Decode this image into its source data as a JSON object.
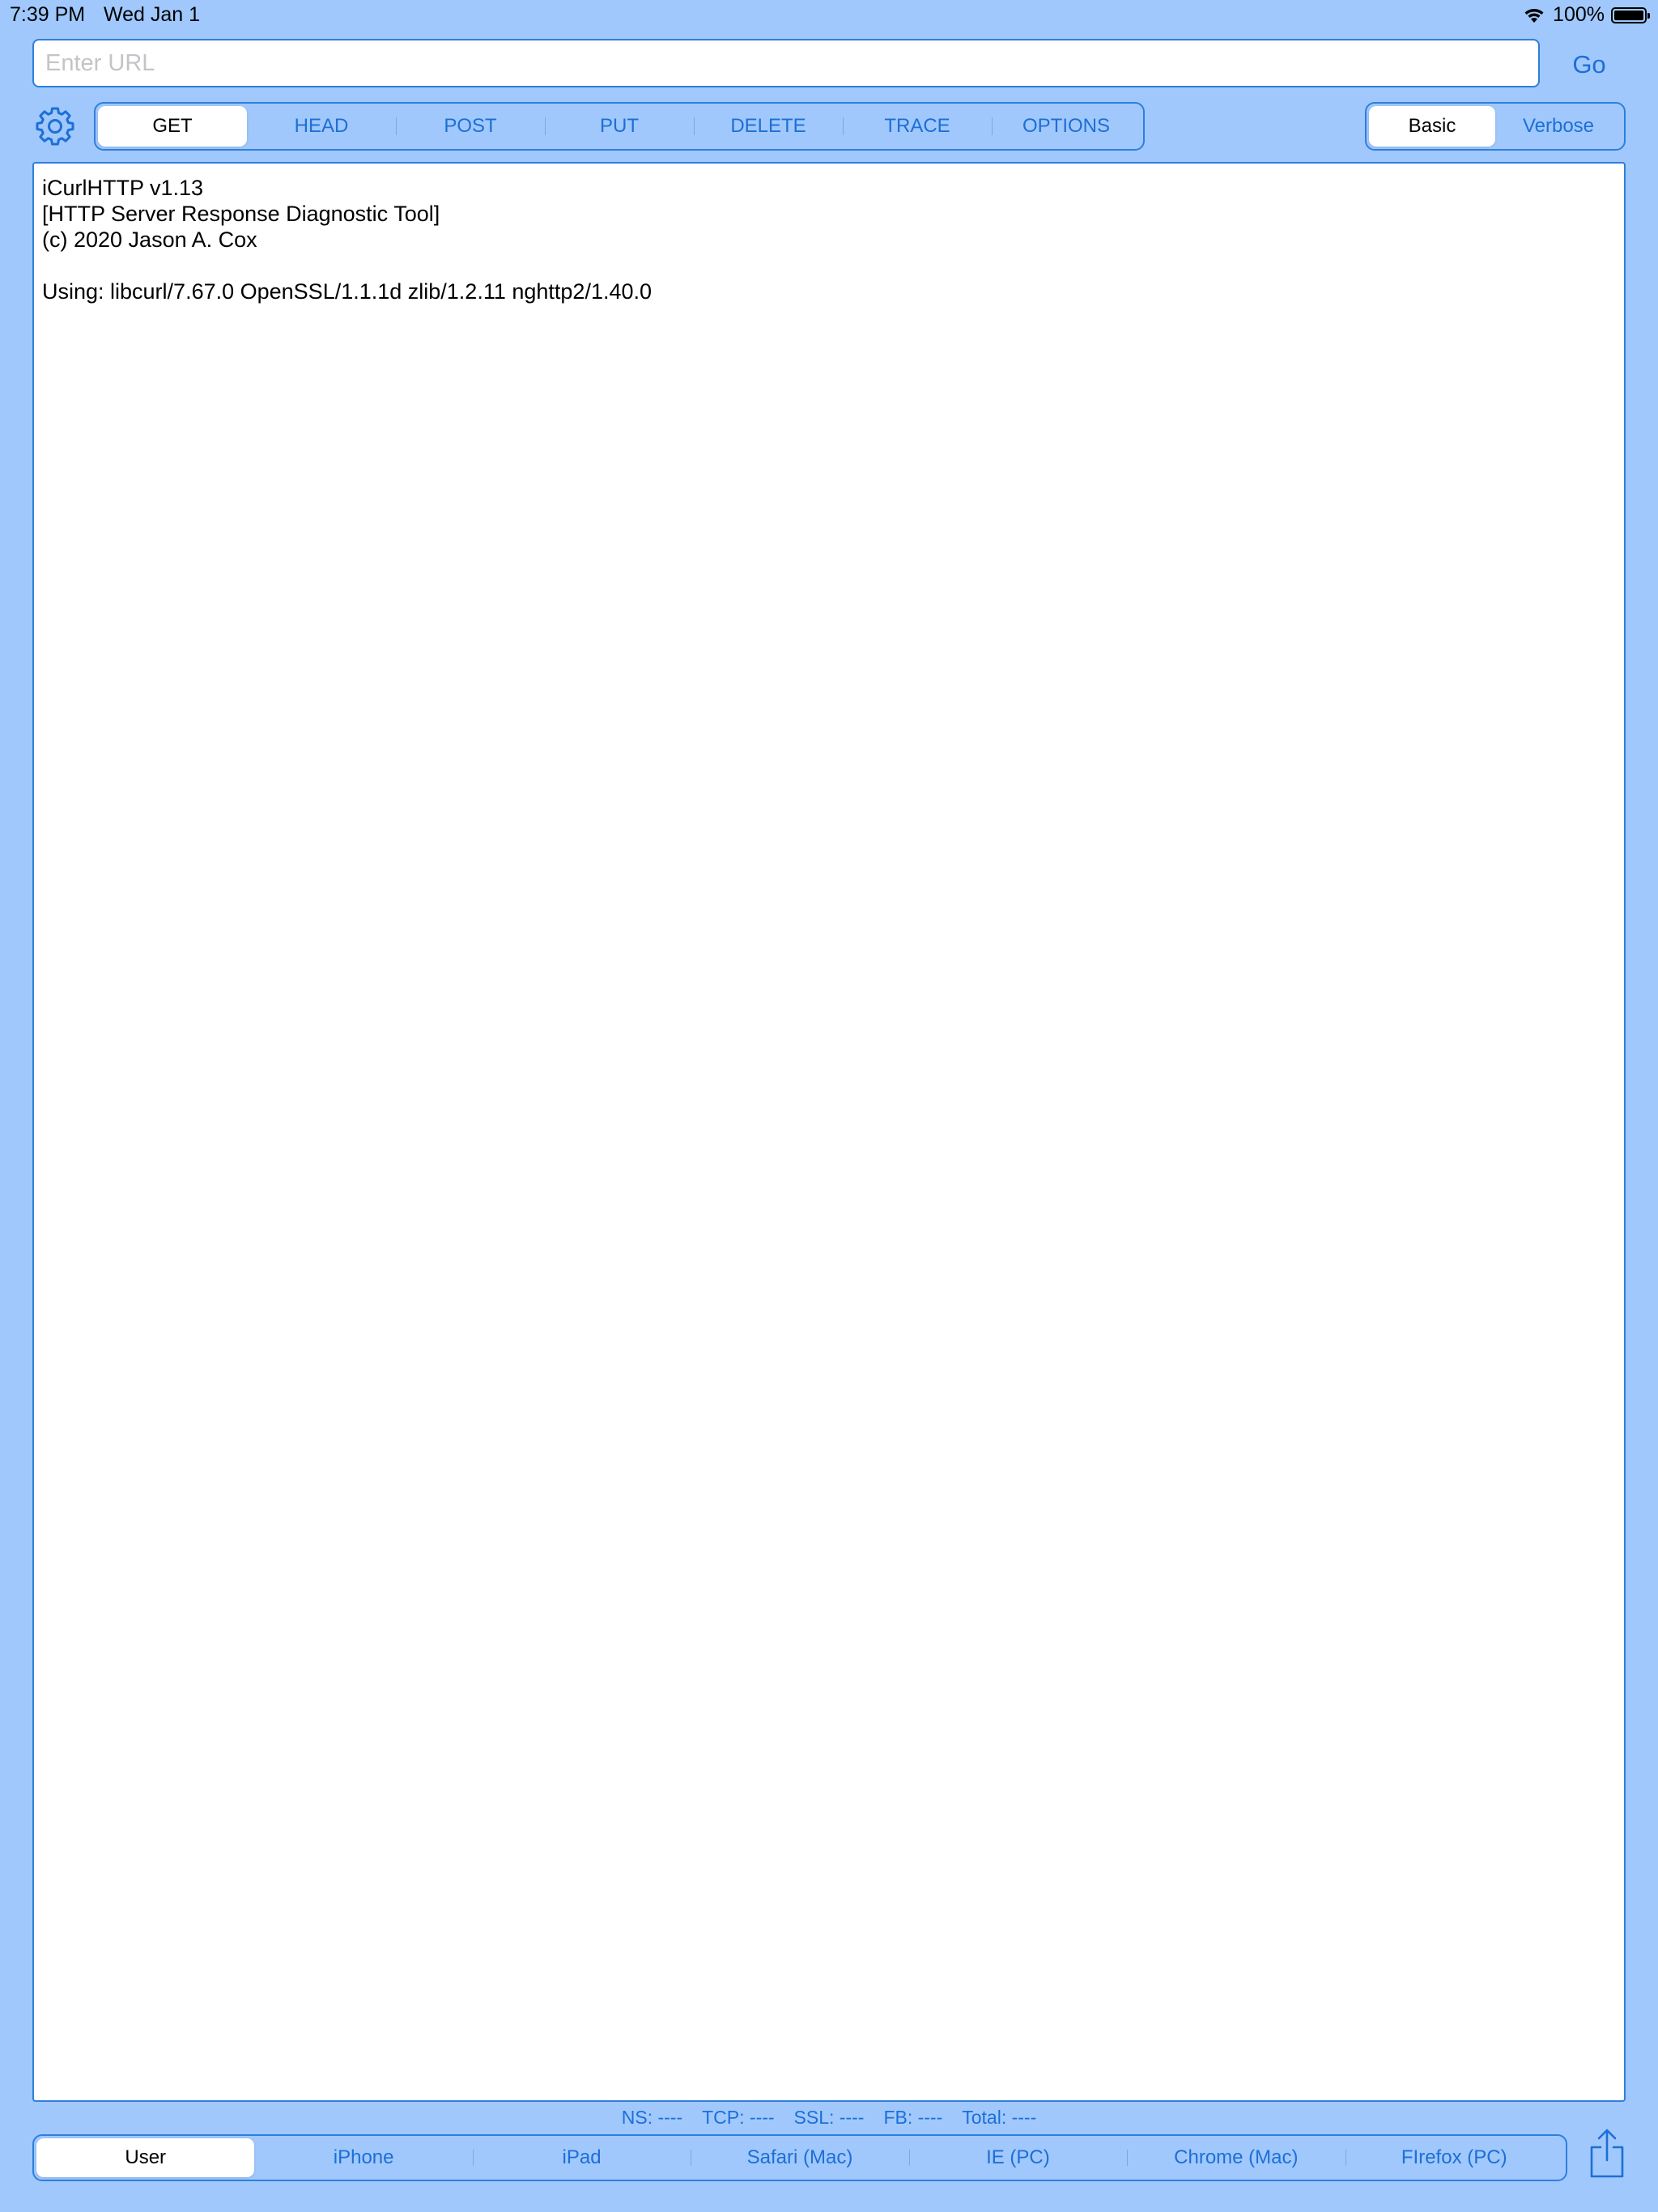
{
  "status_bar": {
    "time": "7:39 PM",
    "date": "Wed Jan 1",
    "battery": "100%",
    "battery_level_percent": 100
  },
  "url_bar": {
    "placeholder": "Enter URL",
    "value": "",
    "go_label": "Go"
  },
  "methods": {
    "items": [
      "GET",
      "HEAD",
      "POST",
      "PUT",
      "DELETE",
      "TRACE",
      "OPTIONS"
    ],
    "selected": "GET"
  },
  "modes": {
    "items": [
      "Basic",
      "Verbose"
    ],
    "selected": "Basic"
  },
  "output": {
    "lines": [
      "iCurlHTTP v1.13",
      "[HTTP Server Response Diagnostic Tool]",
      "(c) 2020 Jason A. Cox",
      "",
      "Using: libcurl/7.67.0 OpenSSL/1.1.1d zlib/1.2.11 nghttp2/1.40.0"
    ]
  },
  "timing": {
    "ns": "NS: ----",
    "tcp": "TCP: ----",
    "ssl": "SSL: ----",
    "fb": "FB: ----",
    "total": "Total: ----"
  },
  "agents": {
    "items": [
      "User",
      "iPhone",
      "iPad",
      "Safari (Mac)",
      "IE (PC)",
      "Chrome (Mac)",
      "FIrefox (PC)"
    ],
    "selected": "User"
  },
  "icons": {
    "settings": "gear-icon",
    "share": "share-icon",
    "wifi": "wifi-icon",
    "battery": "battery-icon"
  },
  "colors": {
    "background": "#a0c8fc",
    "accent": "#1d6fd6",
    "border": "#2e7fdc"
  }
}
